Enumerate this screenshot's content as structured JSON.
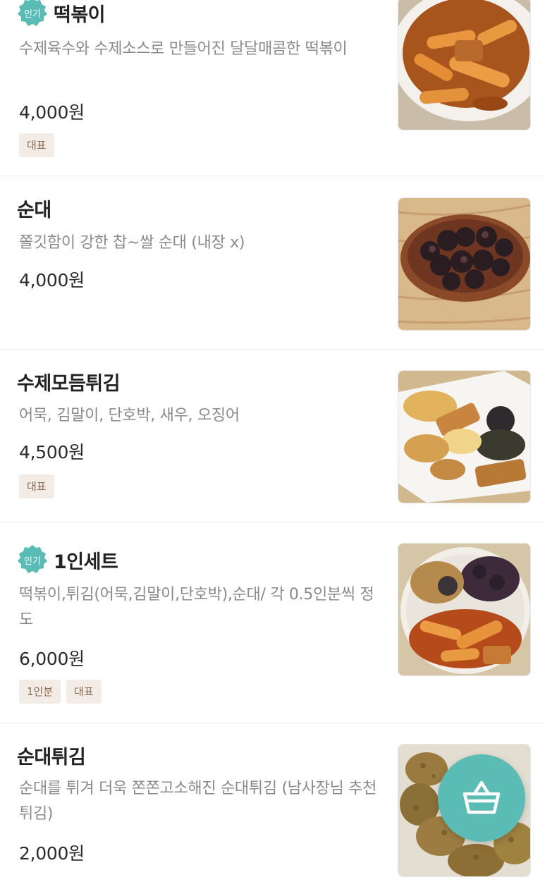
{
  "accent_color": "#5bbcb5",
  "popular_badge_label": "인기",
  "items": [
    {
      "name": "떡볶이",
      "popular": true,
      "description": "수제육수와 수제소스로 만들어진 달달매콤한 떡볶이",
      "price": "4,000원",
      "tags": [
        "대표"
      ],
      "image_icon": "tteokbokki-photo"
    },
    {
      "name": "순대",
      "popular": false,
      "description": "쫄깃함이 강한 찹~쌀 순대 (내장 x)",
      "price": "4,000원",
      "tags": [],
      "image_icon": "sundae-photo"
    },
    {
      "name": "수제모듬튀김",
      "popular": false,
      "description": "어묵, 김말이, 단호박, 새우, 오징어",
      "price": "4,500원",
      "tags": [
        "대표"
      ],
      "image_icon": "fried-mix-photo"
    },
    {
      "name": "1인세트",
      "popular": true,
      "description": "떡볶이,튀김(어묵,김말이,단호박),순대/ 각 0.5인분씩 정도",
      "price": "6,000원",
      "tags": [
        "1인분",
        "대표"
      ],
      "image_icon": "set-meal-photo"
    },
    {
      "name": "순대튀김",
      "popular": false,
      "description": "순대를 튀겨 더욱 쫀쫀고소해진 순대튀김 (남사장님 추천 튀김)",
      "price": "2,000원",
      "tags": [],
      "image_icon": "fried-sundae-photo"
    }
  ],
  "cart_button": {
    "icon": "basket-icon"
  }
}
